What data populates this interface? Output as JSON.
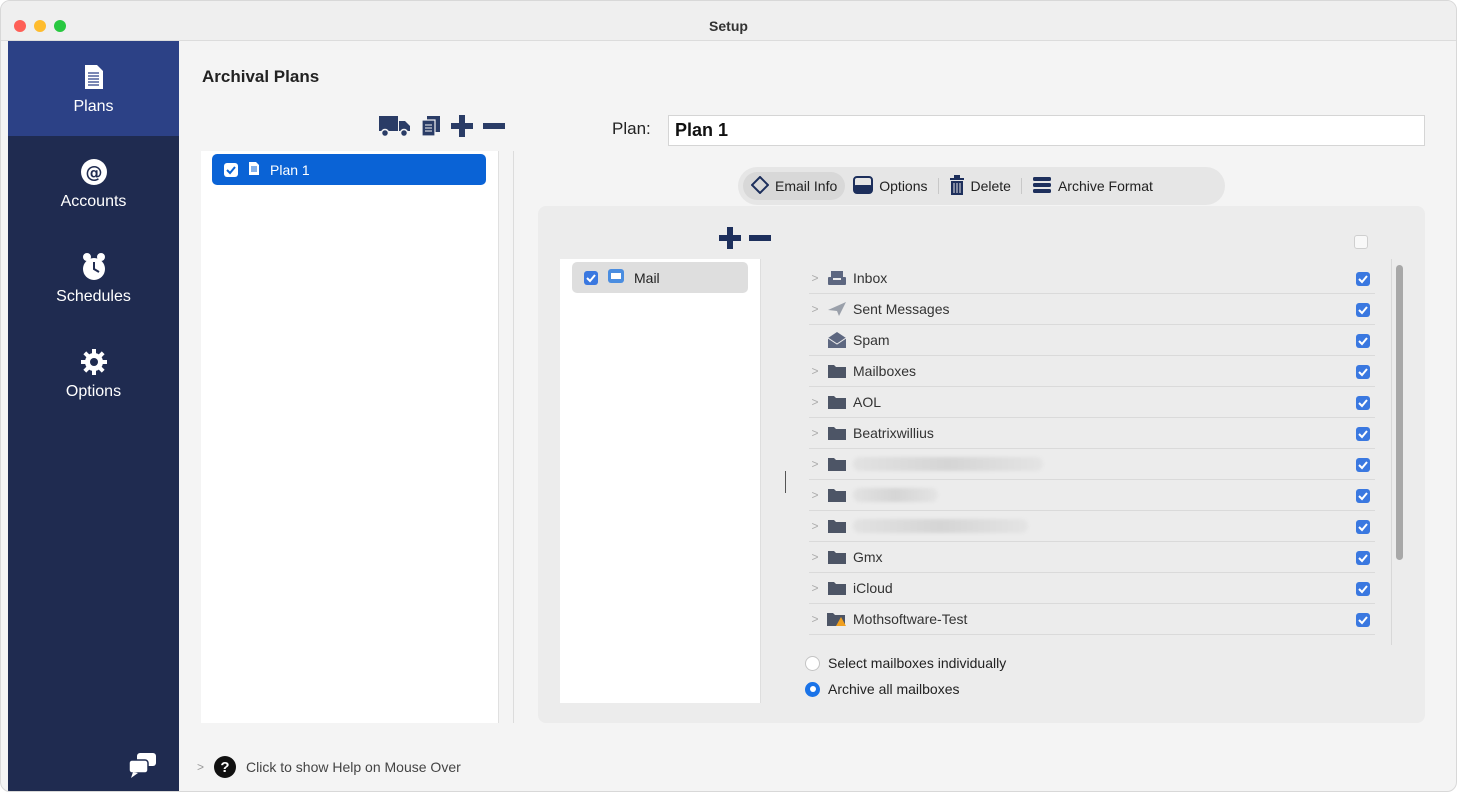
{
  "window": {
    "title": "Setup"
  },
  "sidebar": {
    "items": [
      {
        "label": "Plans",
        "icon": "document-icon",
        "active": true
      },
      {
        "label": "Accounts",
        "icon": "at-sign-icon",
        "active": false
      },
      {
        "label": "Schedules",
        "icon": "alarm-clock-icon",
        "active": false
      },
      {
        "label": "Options",
        "icon": "gear-icon",
        "active": false
      }
    ]
  },
  "main": {
    "title": "Archival Plans",
    "plans": [
      {
        "label": "Plan 1",
        "checked": true
      }
    ],
    "plan_label": "Plan:",
    "plan_name": "Plan 1",
    "tabs": [
      {
        "label": "Email Info",
        "icon": "diamond-icon",
        "active": true
      },
      {
        "label": "Options",
        "icon": "drive-icon",
        "active": false
      },
      {
        "label": "Delete",
        "icon": "trash-icon",
        "active": false
      },
      {
        "label": "Archive Format",
        "icon": "stack-icon",
        "active": false
      }
    ],
    "accounts": [
      {
        "label": "Mail",
        "checked": true
      }
    ],
    "folders": [
      {
        "label": "Inbox",
        "icon": "inbox-icon",
        "expandable": true,
        "checked": true
      },
      {
        "label": "Sent Messages",
        "icon": "paper-plane-icon",
        "expandable": true,
        "checked": true
      },
      {
        "label": "Spam",
        "icon": "spam-icon",
        "expandable": false,
        "checked": true
      },
      {
        "label": "Mailboxes",
        "icon": "folder-icon",
        "expandable": true,
        "checked": true
      },
      {
        "label": "AOL",
        "icon": "folder-icon",
        "expandable": true,
        "checked": true
      },
      {
        "label": "Beatrixwillius",
        "icon": "folder-icon",
        "expandable": true,
        "checked": true
      },
      {
        "label": "",
        "icon": "folder-icon",
        "expandable": true,
        "checked": true,
        "redacted": true
      },
      {
        "label": "",
        "icon": "folder-icon",
        "expandable": true,
        "checked": true,
        "redacted": true
      },
      {
        "label": "",
        "icon": "folder-icon",
        "expandable": true,
        "checked": true,
        "redacted": true
      },
      {
        "label": "Gmx",
        "icon": "folder-icon",
        "expandable": true,
        "checked": true
      },
      {
        "label": "iCloud",
        "icon": "folder-icon",
        "expandable": true,
        "checked": true
      },
      {
        "label": "Mothsoftware-Test",
        "icon": "folder-warning-icon",
        "expandable": true,
        "checked": true
      }
    ],
    "mailbox_mode": {
      "options": [
        "Select mailboxes individually",
        "Archive all mailboxes"
      ],
      "selected": "Archive all mailboxes"
    }
  },
  "help": {
    "label": "Click to show Help on Mouse Over"
  },
  "colors": {
    "sidebar": "#1f2b50",
    "sidebar_active": "#2c4186",
    "selection": "#0a63d6",
    "accent": "#1a73e8"
  }
}
